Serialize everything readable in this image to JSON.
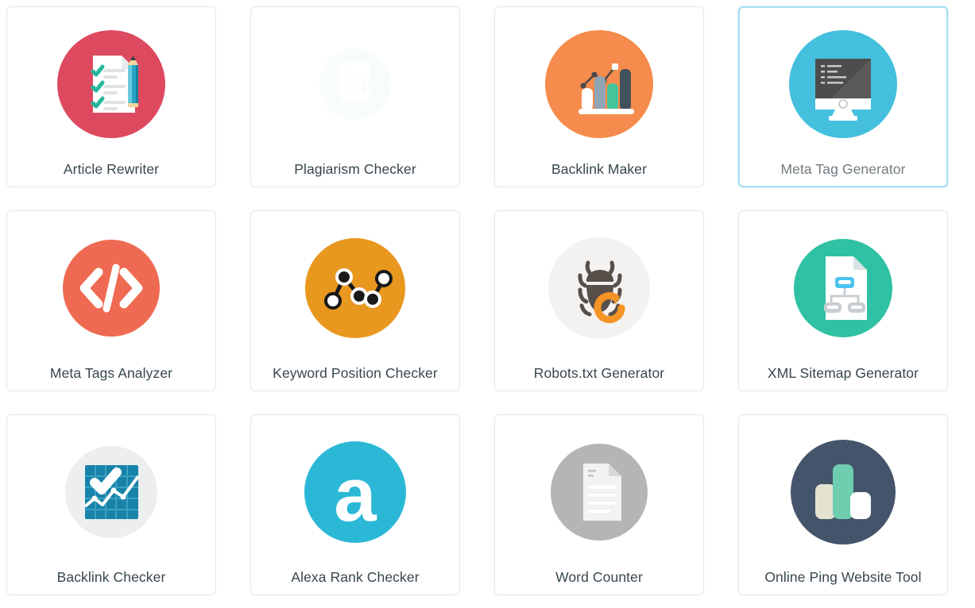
{
  "grid": {
    "columns": 4,
    "rows": 3,
    "selected_index": 3,
    "background_color": "#ffffff",
    "card_border_color": "#e3e6e8",
    "selected_border_color": "#a9dff2",
    "label_color": "#37474f",
    "selected_label_color": "#737b80"
  },
  "tools": [
    {
      "label": "Article Rewriter",
      "icon": "document-checklist-pencil-icon",
      "circle_color": "#dd4a60",
      "selected": false,
      "faded": false
    },
    {
      "label": "Plagiarism Checker",
      "icon": "plagiarism-document-icon",
      "circle_color": "#eef7fa",
      "selected": false,
      "faded": true
    },
    {
      "label": "Backlink Maker",
      "icon": "bar-chart-growth-icon",
      "circle_color": "#f58b4c",
      "selected": false,
      "faded": false
    },
    {
      "label": "Meta Tag Generator",
      "icon": "monitor-code-icon",
      "circle_color": "#44bfdd",
      "selected": true,
      "faded": false
    },
    {
      "label": "Meta Tags Analyzer",
      "icon": "code-brackets-icon",
      "circle_color": "#ef6a52",
      "selected": false,
      "faded": false
    },
    {
      "label": "Keyword Position Checker",
      "icon": "line-graph-nodes-icon",
      "circle_color": "#e8971f",
      "selected": false,
      "faded": false
    },
    {
      "label": "Robots.txt Generator",
      "icon": "bug-refresh-icon",
      "circle_color": "#f4f1f1",
      "selected": false,
      "faded": false
    },
    {
      "label": "XML Sitemap Generator",
      "icon": "sitemap-document-icon",
      "circle_color": "#2fc1a3",
      "selected": false,
      "faded": false
    },
    {
      "label": "Backlink Checker",
      "icon": "chart-check-icon",
      "circle_color": "#eceef0",
      "selected": false,
      "faded": false
    },
    {
      "label": "Alexa Rank Checker",
      "icon": "alexa-letter-a-icon",
      "circle_color": "#2bb8d6",
      "selected": false,
      "faded": false
    },
    {
      "label": "Word Counter",
      "icon": "text-document-icon",
      "circle_color": "#b5b5b5",
      "selected": false,
      "faded": false
    },
    {
      "label": "Online Ping Website Tool",
      "icon": "bar-chart-dark-icon",
      "circle_color": "#44546b",
      "selected": false,
      "faded": false
    }
  ]
}
